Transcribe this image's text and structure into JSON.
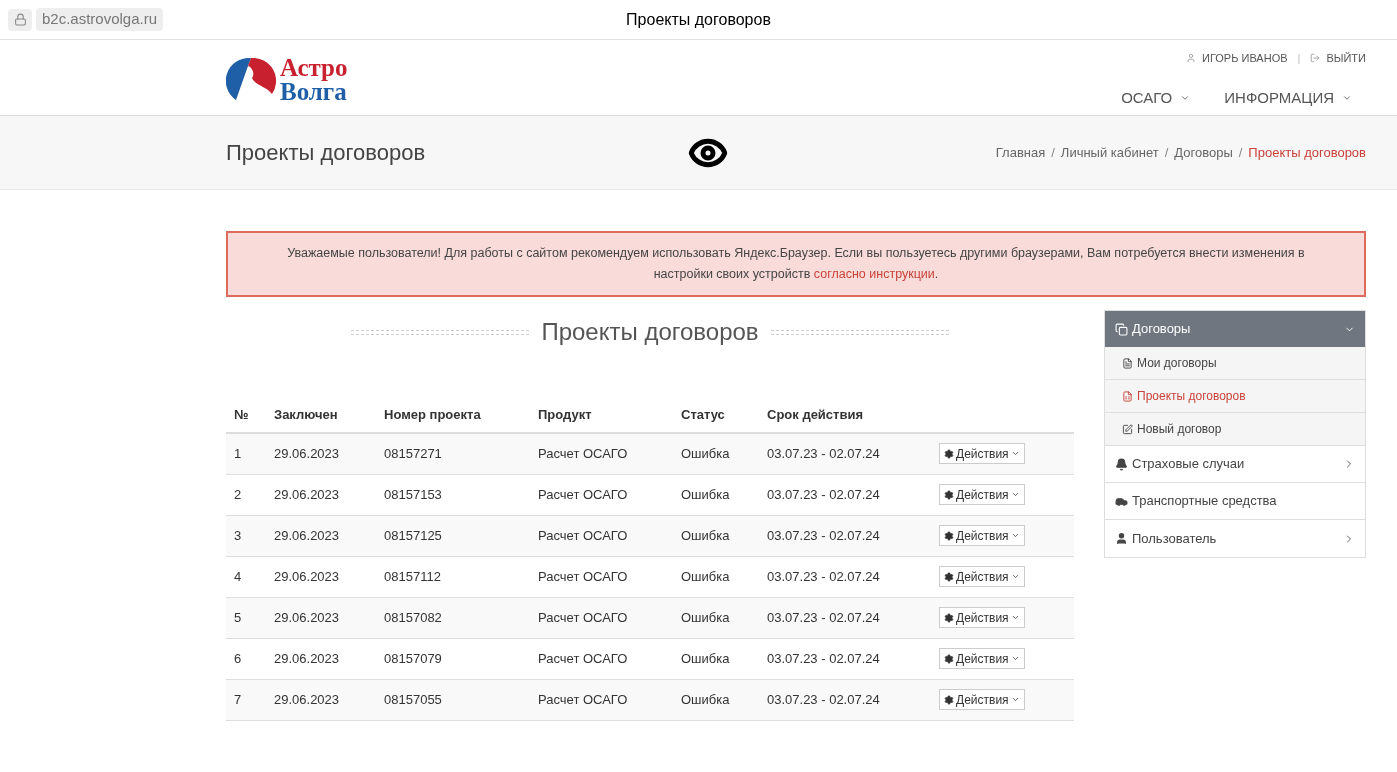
{
  "browser": {
    "url": "b2c.astrovolga.ru",
    "title": "Проекты договоров"
  },
  "header": {
    "logo": [
      "Астро",
      "Волга"
    ],
    "user": "ИГОРЬ ИВАНОВ",
    "separator": "|",
    "logout": "ВЫЙТИ",
    "nav": [
      "ОСАГО",
      "ИНФОРМАЦИЯ"
    ]
  },
  "page_title": "Проекты договоров",
  "breadcrumbs": [
    {
      "label": "Главная",
      "selected": false
    },
    {
      "separator": "/",
      "label": "Личный кабинет",
      "selected": false
    },
    {
      "separator": "/",
      "label": "Договоры",
      "selected": false
    },
    {
      "separator": "/",
      "label": "Проекты договоров",
      "selected": true
    }
  ],
  "alert": {
    "text": "Уважаемые пользователи! Для работы с сайтом рекомендуем использовать Яндекс.Браузер. Если вы пользуетесь другими браузерами, Вам потребуется внести изменения в настройки своих устройств",
    "link": "согласно инструкции",
    "end": "."
  },
  "section_title": "Проекты договоров",
  "table": {
    "columns": [
      "№",
      "Заключен",
      "Номер проекта",
      "Продукт",
      "Статус",
      "Срок действия"
    ],
    "rows": [
      {
        "cells": [
          "1",
          "29.06.2023",
          "08157271",
          "Расчет ОСАГО",
          "Ошибка",
          "03.07.23 - 02.07.24"
        ],
        "action": "Действия"
      },
      {
        "cells": [
          "2",
          "29.06.2023",
          "08157153",
          "Расчет ОСАГО",
          "Ошибка",
          "03.07.23 - 02.07.24"
        ],
        "action": "Действия"
      },
      {
        "cells": [
          "3",
          "29.06.2023",
          "08157125",
          "Расчет ОСАГО",
          "Ошибка",
          "03.07.23 - 02.07.24"
        ],
        "action": "Действия"
      },
      {
        "cells": [
          "4",
          "29.06.2023",
          "08157112",
          "Расчет ОСАГО",
          "Ошибка",
          "03.07.23 - 02.07.24"
        ],
        "action": "Действия"
      },
      {
        "cells": [
          "5",
          "29.06.2023",
          "08157082",
          "Расчет ОСАГО",
          "Ошибка",
          "03.07.23 - 02.07.24"
        ],
        "action": "Действия"
      },
      {
        "cells": [
          "6",
          "29.06.2023",
          "08157079",
          "Расчет ОСАГО",
          "Ошибка",
          "03.07.23 - 02.07.24"
        ],
        "action": "Действия"
      },
      {
        "cells": [
          "7",
          "29.06.2023",
          "08157055",
          "Расчет ОСАГО",
          "Ошибка",
          "03.07.23 - 02.07.24"
        ],
        "action": "Действия"
      }
    ]
  },
  "sidebar": [
    {
      "kind": "header",
      "label": "Договоры",
      "expanded": true
    },
    {
      "kind": "sub",
      "label": "Мои договоры",
      "selected": false
    },
    {
      "kind": "sub",
      "label": "Проекты договоров",
      "selected": true
    },
    {
      "kind": "sub",
      "label": "Новый договор",
      "selected": false
    },
    {
      "kind": "item",
      "label": "Страховые случаи",
      "has_children": true
    },
    {
      "kind": "item",
      "label": "Транспортные средства",
      "has_children": false
    },
    {
      "kind": "item",
      "label": "Пользователь",
      "has_children": true
    }
  ]
}
